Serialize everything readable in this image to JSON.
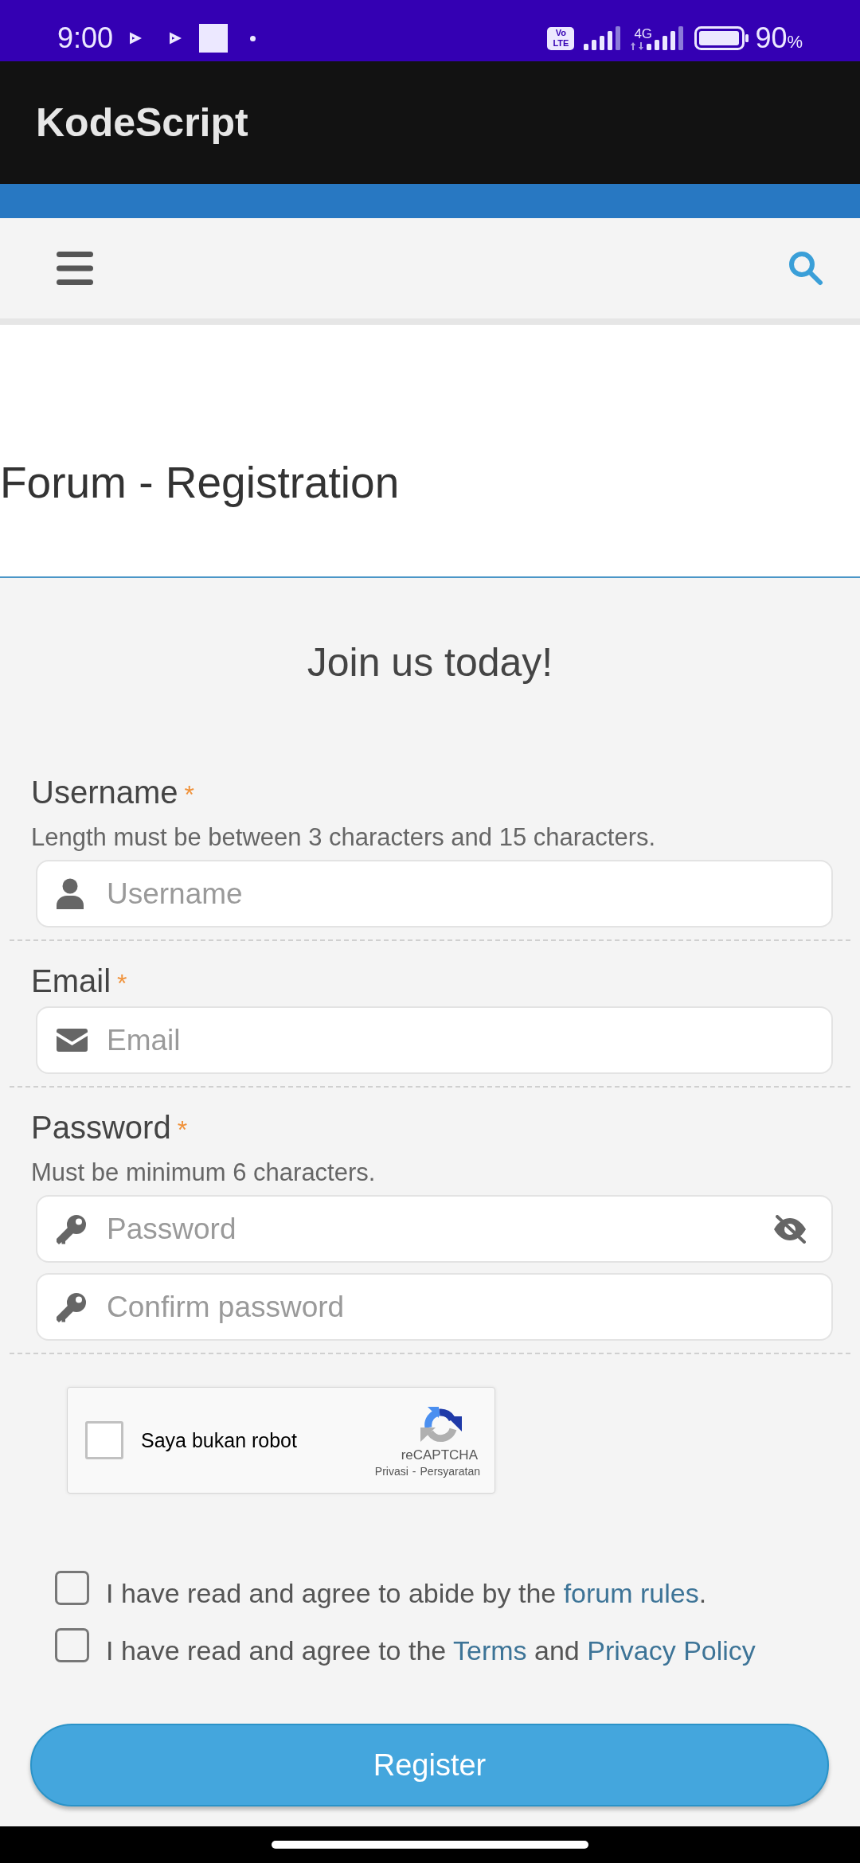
{
  "status_bar": {
    "time": "9:00",
    "volte_badge": "Vo LTE",
    "network_type": "4G",
    "battery_percent": "90",
    "battery_unit": "%"
  },
  "app_bar": {
    "title": "KodeScript"
  },
  "page_title": "Forum - Registration",
  "form": {
    "heading": "Join us today!",
    "groups": [
      {
        "label": "Username",
        "required_mark": "*",
        "hint": "Length must be between 3 characters and 15 characters.",
        "inputs": [
          {
            "kind": "username",
            "placeholder": "Username"
          }
        ]
      },
      {
        "label": "Email",
        "required_mark": "*",
        "inputs": [
          {
            "kind": "email",
            "placeholder": "Email"
          }
        ]
      },
      {
        "label": "Password",
        "required_mark": "*",
        "hint": "Must be minimum 6 characters.",
        "inputs": [
          {
            "kind": "password",
            "placeholder": "Password",
            "show_toggle": true
          },
          {
            "kind": "password",
            "placeholder": "Confirm password",
            "show_toggle": false
          }
        ]
      }
    ],
    "captcha": {
      "label": "Saya bukan robot",
      "checked": false,
      "brand": "reCAPTCHA",
      "privacy_link": "Privasi",
      "separator": "-",
      "terms_link": "Persyaratan"
    },
    "agreements": [
      {
        "checked": false,
        "parts": [
          {
            "kind": "text",
            "text": "I have read and agree to abide by the "
          },
          {
            "kind": "link",
            "text": "forum rules"
          },
          {
            "kind": "text",
            "text": "."
          }
        ]
      },
      {
        "checked": false,
        "parts": [
          {
            "kind": "text",
            "text": "I have read and agree to the "
          },
          {
            "kind": "link",
            "text": "Terms"
          },
          {
            "kind": "text",
            "text": " and "
          },
          {
            "kind": "link",
            "text": "Privacy Policy"
          }
        ]
      }
    ],
    "submit": {
      "label": "Register"
    }
  }
}
